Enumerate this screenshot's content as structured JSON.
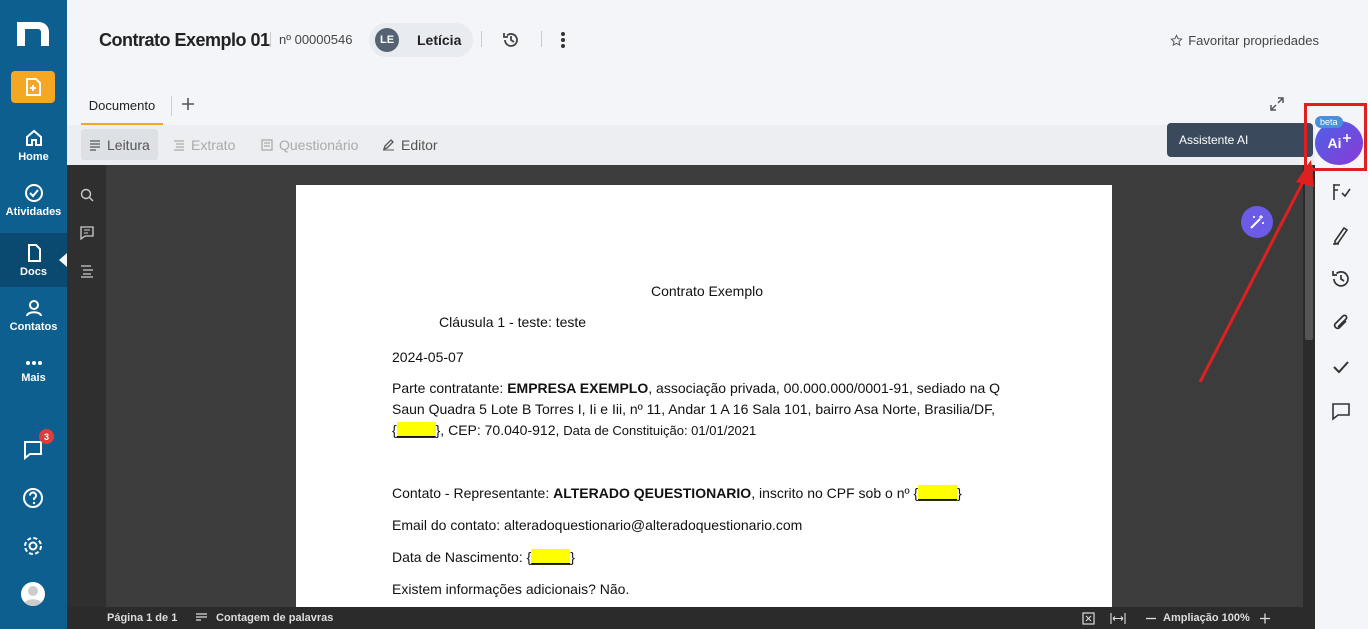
{
  "sidebar": {
    "items": [
      {
        "label": "Home",
        "icon": "home-icon"
      },
      {
        "label": "Atividades",
        "icon": "check-circle-icon"
      },
      {
        "label": "Docs",
        "icon": "document-icon"
      },
      {
        "label": "Contatos",
        "icon": "user-icon"
      },
      {
        "label": "Mais",
        "icon": "more-icon"
      }
    ],
    "chat_badge": "3"
  },
  "header": {
    "title": "Contrato Exemplo 01",
    "number": "nº 00000546",
    "user_initials": "LE",
    "user_name": "Letícia",
    "favorite_label": "Favoritar propriedades"
  },
  "tabs": {
    "active": "Documento"
  },
  "modes": [
    "Leitura",
    "Extrato",
    "Questionário",
    "Editor"
  ],
  "assistant": {
    "tooltip": "Assistente AI",
    "button": "Ai",
    "beta": "beta"
  },
  "document": {
    "title": "Contrato Exemplo",
    "clause": "Cláusula 1 - teste: teste",
    "date": "2024-05-07",
    "party_prefix": "Parte contratante: ",
    "party_name": "EMPRESA EXEMPLO",
    "party_line1": ", associação privada, 00.000.000/0001-91, sediado na Q",
    "party_line2": "Saun Quadra 5 Lote B Torres I, Ii e Iii, nº 11, Andar 1 A 16 Sala 101, bairro Asa Norte, Brasilia/DF,",
    "party_line3_pre": "{",
    "placeholder": "_____",
    "party_line3_post": "}, CEP: 70.040-912, ",
    "party_line3_small": "Data de Constituição: 01/01/2021",
    "contact_prefix": "Contato - Representante: ",
    "contact_name": "ALTERADO QEUESTIONARIO",
    "contact_suffix": ", inscrito no CPF sob o nº {",
    "email": "Email do contato: alteradoquestionario@alteradoquestionario.com",
    "birth_prefix": "Data de Nascimento: {",
    "extra": "Existem informações adicionais? Não."
  },
  "statusbar": {
    "page": "Página 1 de 1",
    "wordcount": "Contagem de palavras",
    "zoom": "Ampliação 100%"
  }
}
